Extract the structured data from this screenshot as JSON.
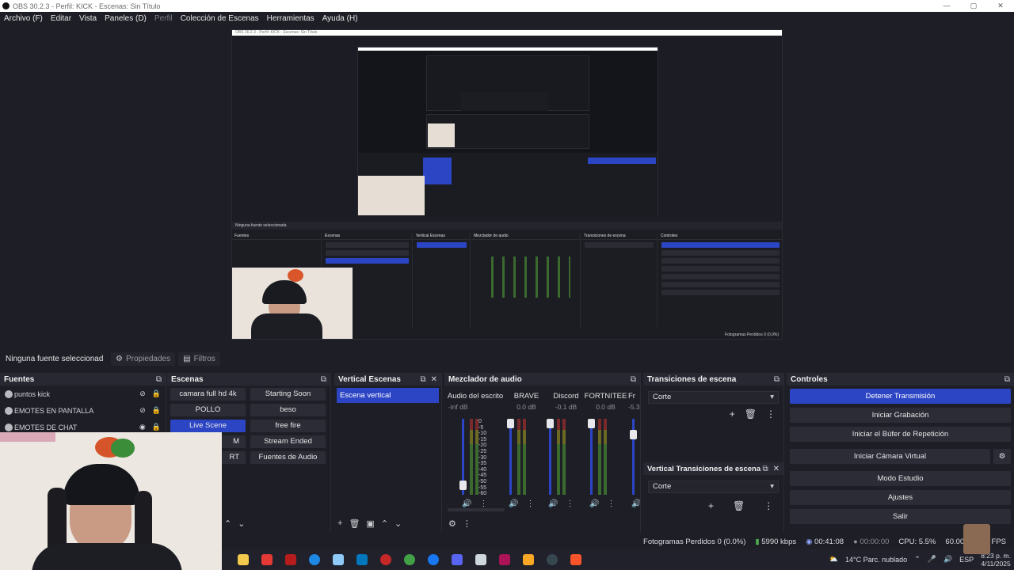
{
  "window": {
    "title": "OBS 30.2.3 - Perfil: KICK - Escenas: Sin Título",
    "minimize": "—",
    "maximize": "▢",
    "close": "✕"
  },
  "menu": {
    "items": [
      "Archivo (F)",
      "Editar",
      "Vista",
      "Paneles (D)",
      "Perfil",
      "Colección de Escenas",
      "Herramientas",
      "Ayuda (H)"
    ]
  },
  "source_bar": {
    "no_source": "Ninguna fuente seleccionad",
    "properties": "Propiedades",
    "filters": "Filtros"
  },
  "fuentes": {
    "title": "Fuentes",
    "items": [
      {
        "label": "puntos kick"
      },
      {
        "label": "EMOTES EN PANTALLA"
      },
      {
        "label": "EMOTES DE CHAT"
      }
    ]
  },
  "escenas": {
    "title": "Escenas",
    "buttons": [
      "camara full hd 4k",
      "Starting Soon",
      "POLLO",
      "beso",
      "Live Scene",
      "free fire",
      "M",
      "Stream Ended",
      "RT",
      "Fuentes de Audio"
    ],
    "active": "Live Scene"
  },
  "vertical_escenas": {
    "title": "Vertical Escenas",
    "item": "Escena vertical"
  },
  "mezclador": {
    "title": "Mezclador de audio",
    "channels": [
      {
        "name": "Audio del escrito",
        "db": "-inf dB"
      },
      {
        "name": "BRAVE",
        "db": "0.0 dB"
      },
      {
        "name": "Discord",
        "db": "-0.1 dB"
      },
      {
        "name": "FORTNITEE",
        "db": "0.0 dB"
      },
      {
        "name": "Fr",
        "db": "-5.3"
      }
    ],
    "scale": [
      "0",
      "-5",
      "-10",
      "-15",
      "-20",
      "-25",
      "-30",
      "-35",
      "-40",
      "-45",
      "-50",
      "-55",
      "-60"
    ]
  },
  "transiciones": {
    "title": "Transiciones de escena",
    "value": "Corte"
  },
  "vertical_transiciones": {
    "title": "Vertical Transiciones de escena",
    "value": "Corte"
  },
  "controles": {
    "title": "Controles",
    "buttons": [
      "Detener Transmisión",
      "Iniciar Grabación",
      "Iniciar el Búfer de Repetición",
      "Iniciar Cámara Virtual",
      "Modo Estudio",
      "Ajustes",
      "Salir"
    ]
  },
  "status": {
    "dropped": "Fotogramas Perdidos 0 (0.0%)",
    "bitrate": "5990 kbps",
    "stream_time": "00:41:08",
    "rec_time": "00:00:00",
    "cpu": "CPU: 5.5%",
    "fps": "60.00 / 60.00 FPS"
  },
  "taskbar": {
    "weather": "14°C  Parc. nublado",
    "lang": "ESP",
    "time": "8:23 p. m.",
    "date": "4/11/2025"
  },
  "preview_text": {
    "none": "Ninguna fuente seleccionada",
    "dock_titles": [
      "Fuentes",
      "Escenas",
      "Vertical Escenas",
      "Mezclador de audio",
      "Transiciones de escena",
      "Controles"
    ]
  },
  "colors": {
    "accent": "#2c45c4",
    "bg": "#1e1f26"
  }
}
